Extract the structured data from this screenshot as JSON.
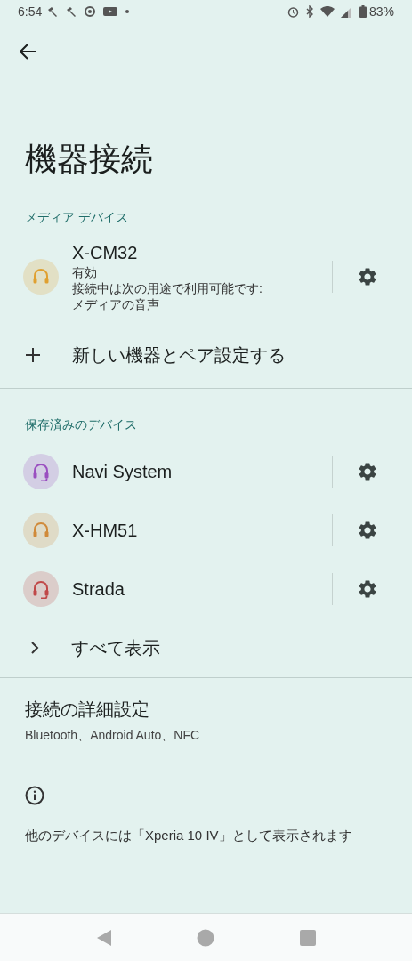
{
  "status_bar": {
    "time": "6:54",
    "battery": "83%"
  },
  "title": "機器接続",
  "media_section": {
    "header": "メディア デバイス",
    "device": {
      "name": "X-CM32",
      "kind": "headphones",
      "color": "#e0a030",
      "lines": [
        "有効",
        "接続中は次の用途で利用可能です:",
        "メディアの音声"
      ]
    },
    "pair_action": {
      "label": "新しい機器とペア設定する"
    }
  },
  "saved_section": {
    "header": "保存済みのデバイス",
    "devices": [
      {
        "name": "Navi System",
        "kind": "headset",
        "color": "#9a4fc0"
      },
      {
        "name": "X-HM51",
        "kind": "headphones",
        "color": "#d08a3a"
      },
      {
        "name": "Strada",
        "kind": "headset",
        "color": "#c04848"
      }
    ],
    "show_all": {
      "label": "すべて表示"
    }
  },
  "advanced": {
    "title": "接続の詳細設定",
    "subtitle": "Bluetooth、Android Auto、NFC"
  },
  "footer_note": "他のデバイスには「Xperia 10 IV」として表示されます"
}
